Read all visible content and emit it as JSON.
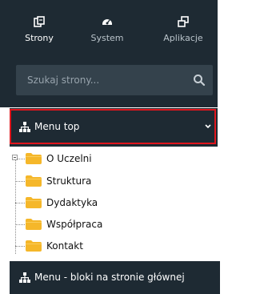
{
  "tabs": [
    {
      "label": "Strony",
      "icon": "pages-icon",
      "active": true
    },
    {
      "label": "System",
      "icon": "dashboard-icon",
      "active": false
    },
    {
      "label": "Aplikacje",
      "icon": "windows-icon",
      "active": false
    }
  ],
  "search": {
    "placeholder": "Szukaj strony...",
    "value": ""
  },
  "menus": [
    {
      "label": "Menu top",
      "expanded": true,
      "items": [
        "O Uczelni",
        "Struktura",
        "Dydaktyka",
        "Współpraca",
        "Kontakt"
      ]
    },
    {
      "label": "Menu - bloki na stronie głównej",
      "expanded": false
    }
  ],
  "colors": {
    "panel": "#1e2a33",
    "search_bg": "#34424c",
    "highlight_border": "#e0161d",
    "folder": "#f5b72a"
  }
}
